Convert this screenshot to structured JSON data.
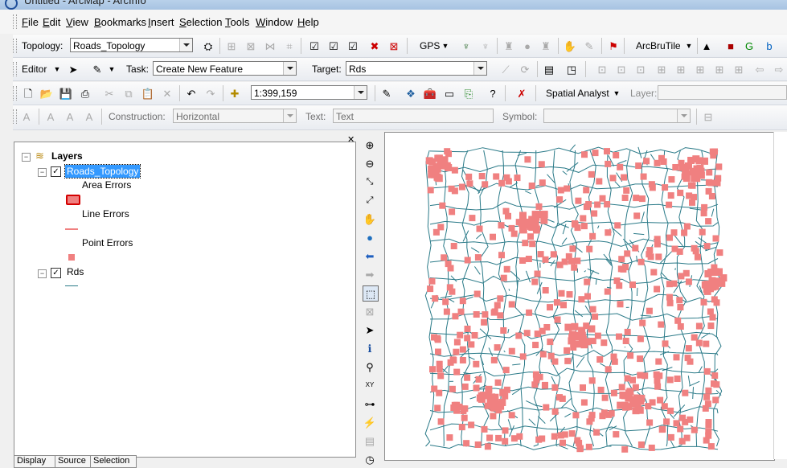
{
  "window": {
    "title": "Untitled - ArcMap - ArcInfo"
  },
  "menu": [
    "File",
    "Edit",
    "View",
    "Bookmarks",
    "Insert",
    "Selection",
    "Tools",
    "Window",
    "Help"
  ],
  "topology_toolbar": {
    "label": "Topology:",
    "value": "Roads_Topology",
    "gps_label": "GPS",
    "arcbrutile_label": "ArcBruTile"
  },
  "editor_toolbar": {
    "editor_label": "Editor",
    "task_label": "Task:",
    "task_value": "Create New Feature",
    "target_label": "Target:",
    "target_value": "Rds"
  },
  "standard_toolbar": {
    "scale_value": "1:399,159",
    "spatial_analyst_label": "Spatial Analyst",
    "layer_label": "Layer:"
  },
  "annotation_toolbar": {
    "construction_label": "Construction:",
    "construction_value": "Horizontal",
    "text_label": "Text:",
    "text_value": "Text",
    "symbol_label": "Symbol:"
  },
  "toc": {
    "layers_label": "Layers",
    "topology_layer": "Roads_Topology",
    "area_errors": "Area Errors",
    "line_errors": "Line Errors",
    "point_errors": "Point Errors",
    "rds_layer": "Rds"
  },
  "tabs": [
    "Display",
    "Source",
    "Selection"
  ],
  "colors": {
    "error_fill": "#f08080",
    "area_error_border": "#d40000",
    "road_line": "#2a7a88",
    "selection_highlight": "#3399ff"
  },
  "icons": {
    "tools": [
      "zoom-in-icon",
      "zoom-out-icon",
      "fixed-zoom-in-icon",
      "fixed-zoom-out-icon",
      "pan-icon",
      "full-extent-icon",
      "back-extent-icon",
      "forward-extent-icon",
      "select-features-icon",
      "clear-selection-icon",
      "select-elements-icon",
      "identify-icon",
      "find-icon",
      "go-to-xy-icon",
      "measure-icon",
      "hyperlink-icon",
      "html-popup-icon",
      "time-slider-icon"
    ]
  }
}
